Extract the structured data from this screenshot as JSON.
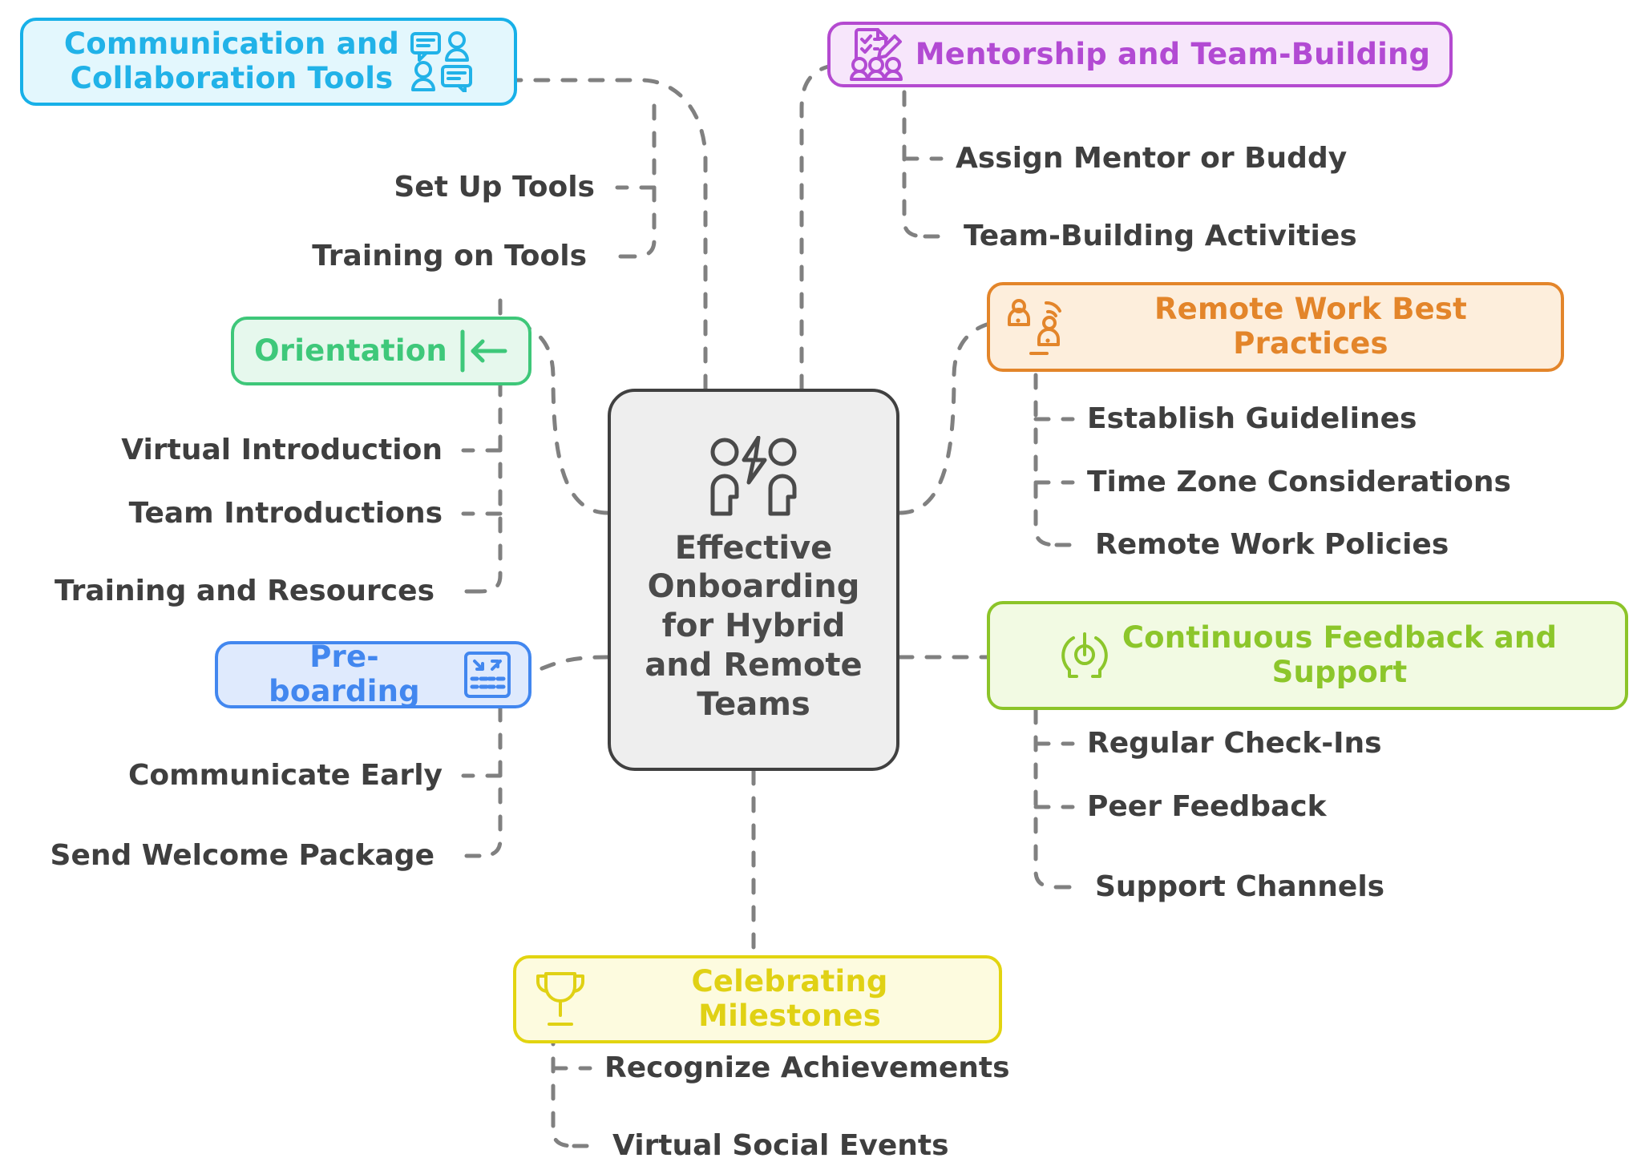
{
  "diagram": {
    "type": "mindmap",
    "central": {
      "title": "Effective\nOnboarding\nfor Hybrid\nand Remote\nTeams",
      "icon": "two-people-lightning-icon",
      "fill": "#eeeeee",
      "stroke": "#404040",
      "text_color": "#4a4a4a"
    },
    "branches": [
      {
        "id": "communication",
        "label": "Communication and\nCollaboration Tools",
        "icon": "chat-people-icon",
        "icon_side": "right",
        "fill": "#e3f7fd",
        "stroke": "#17b0e8",
        "text_color": "#21b2e8",
        "children": [
          "Set Up Tools",
          "Training on Tools"
        ]
      },
      {
        "id": "mentorship",
        "label": "Mentorship and Team-Building",
        "icon": "checklist-pencil-group-icon",
        "icon_side": "left",
        "fill": "#f7e6fb",
        "stroke": "#b44ad0",
        "text_color": "#b24ad3",
        "children": [
          "Assign Mentor or Buddy",
          "Team-Building Activities"
        ]
      },
      {
        "id": "remote-work",
        "label": "Remote Work Best Practices",
        "icon": "remote-worker-wifi-icon",
        "icon_side": "left",
        "fill": "#fdeedc",
        "stroke": "#e3852a",
        "text_color": "#e3852a",
        "children": [
          "Establish Guidelines",
          "Time Zone Considerations",
          "Remote Work Policies"
        ]
      },
      {
        "id": "feedback",
        "label": "Continuous Feedback and\nSupport",
        "icon": "feedback-loop-icon",
        "icon_side": "left",
        "fill": "#f2fae3",
        "stroke": "#8cc429",
        "text_color": "#8cc62b",
        "children": [
          "Regular Check-Ins",
          "Peer Feedback",
          "Support Channels"
        ]
      },
      {
        "id": "milestones",
        "label": "Celebrating Milestones",
        "icon": "trophy-icon",
        "icon_side": "left",
        "fill": "#fdfbdf",
        "stroke": "#e2d410",
        "text_color": "#e0d114",
        "children": [
          "Recognize Achievements",
          "Virtual Social Events"
        ]
      },
      {
        "id": "preboarding",
        "label": "Pre-boarding",
        "icon": "spreadsheet-arrows-icon",
        "icon_side": "right",
        "fill": "#dfeafd",
        "stroke": "#4287ef",
        "text_color": "#4287ef",
        "children": [
          "Communicate Early",
          "Send Welcome Package"
        ]
      },
      {
        "id": "orientation",
        "label": "Orientation",
        "icon": "arrow-to-left-bar-icon",
        "icon_side": "right",
        "fill": "#e6f8ed",
        "stroke": "#3ec779",
        "text_color": "#3ec87a",
        "children": [
          "Virtual Introduction",
          "Team Introductions",
          "Training and Resources"
        ]
      }
    ],
    "connector": {
      "color": "#808080",
      "style": "dashed"
    }
  }
}
